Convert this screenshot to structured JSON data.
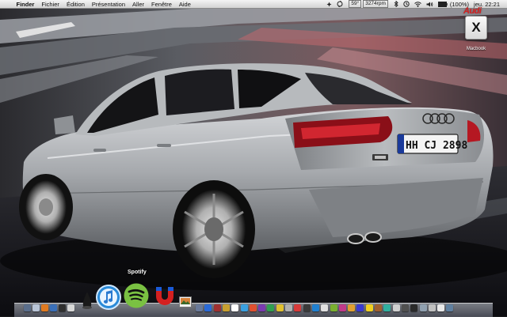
{
  "menubar": {
    "apple_symbol": "",
    "items": [
      "Finder",
      "Fichier",
      "Édition",
      "Présentation",
      "Aller",
      "Fenêtre",
      "Aide"
    ],
    "status": {
      "temperature": "59°",
      "fan_speed": "3274rpm",
      "battery": "(100%)",
      "clock": "jeu. 22:21"
    }
  },
  "brand_logo": "Audi",
  "desktop_icons": [
    {
      "label": "Macbook",
      "glyph": "X",
      "icon": "mac-os-x-drive-icon"
    }
  ],
  "dock": {
    "tooltip": "Spotify",
    "featured": [
      {
        "name": "itunes-icon"
      },
      {
        "name": "spotify-icon"
      },
      {
        "name": "magnet-icon"
      }
    ],
    "small_icon_colors": [
      "#5a6e8c",
      "#b8c4d6",
      "#e07a20",
      "#3a6fb8",
      "#2f2f2f",
      "#d8d8d8",
      "#6a7a9a",
      "#2a6ad8",
      "#a03030",
      "#c8a030",
      "#ffffff",
      "#3aa0e0",
      "#e05030",
      "#7a3ab0",
      "#30a050",
      "#e0c030",
      "#b0b0b0",
      "#d83a3a",
      "#3a3a3a",
      "#2080d0",
      "#e0e0e0",
      "#7ab030",
      "#c03a8a",
      "#e0a030",
      "#3a3ad0",
      "#f0d020",
      "#a06030",
      "#30b0a0",
      "#d0d0d0",
      "#505050",
      "#2a2a2a",
      "#90a0b0",
      "#c0c0c0",
      "#e8e8e8",
      "#6080a0"
    ]
  },
  "car": {
    "plate": "HH CJ 2898"
  }
}
